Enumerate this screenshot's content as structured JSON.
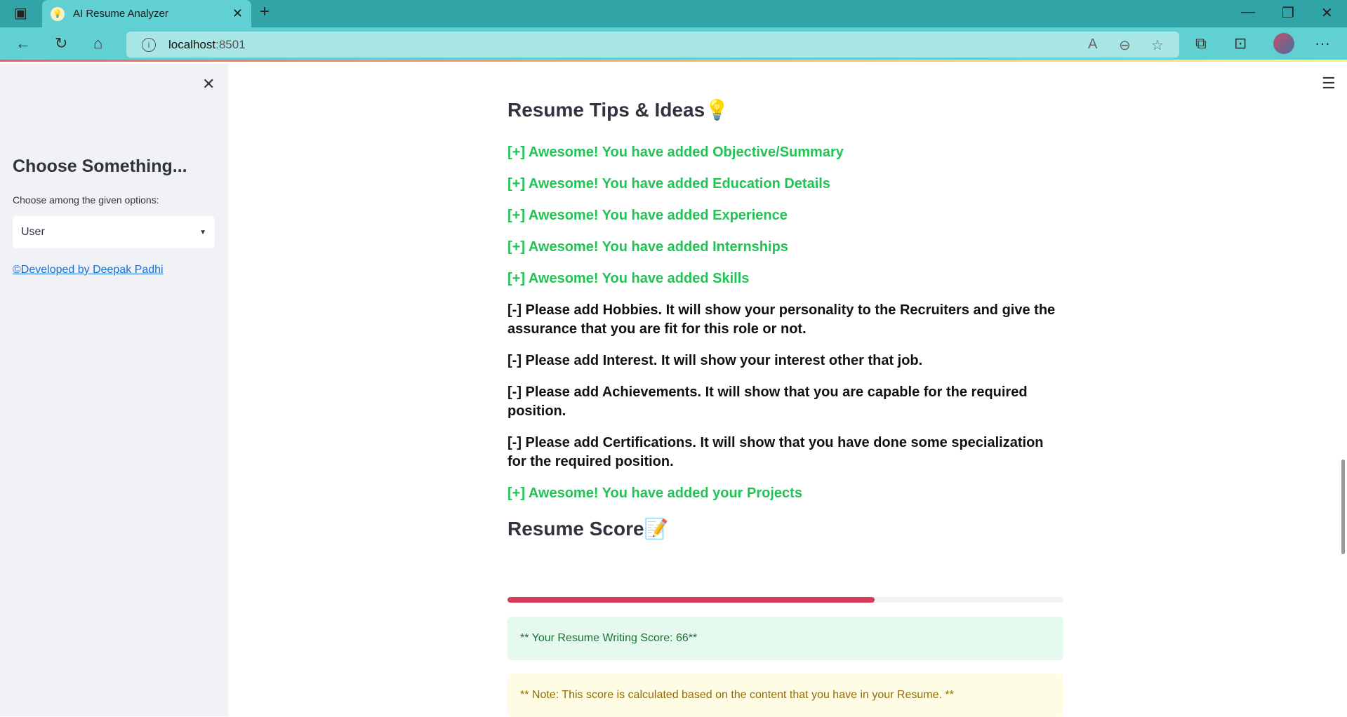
{
  "browser": {
    "tab_title": "AI Resume Analyzer",
    "url_host": "localhost",
    "url_port": ":8501"
  },
  "sidebar": {
    "title": "Choose Something...",
    "select_label": "Choose among the given options:",
    "select_value": "User",
    "footer_link": "©Developed by Deepak Padhi"
  },
  "main": {
    "tips_heading": "Resume Tips & Ideas💡",
    "tips": [
      {
        "text": "[+] Awesome! You have added Objective/Summary",
        "status": "good"
      },
      {
        "text": "[+] Awesome! You have added Education Details",
        "status": "good"
      },
      {
        "text": "[+] Awesome! You have added Experience",
        "status": "good"
      },
      {
        "text": "[+] Awesome! You have added Internships",
        "status": "good"
      },
      {
        "text": "[+] Awesome! You have added Skills",
        "status": "good"
      },
      {
        "text": "[-] Please add Hobbies. It will show your personality to the Recruiters and give the assurance that you are fit for this role or not.",
        "status": "bad"
      },
      {
        "text": "[-] Please add Interest. It will show your interest other that job.",
        "status": "bad"
      },
      {
        "text": "[-] Please add Achievements. It will show that you are capable for the required position.",
        "status": "bad"
      },
      {
        "text": "[-] Please add Certifications. It will show that you have done some specialization for the required position.",
        "status": "bad"
      },
      {
        "text": "[+] Awesome! You have added your Projects",
        "status": "good"
      }
    ],
    "score_heading": "Resume Score📝",
    "score_progress": 66,
    "score_text": "** Your Resume Writing Score: 66**",
    "note_text": "** Note: This score is calculated based on the content that you have in your Resume. **"
  },
  "colors": {
    "good": "#21c354",
    "progress": "#d83c5b",
    "tabbar": "#31a4a7",
    "toolbar": "#61d0d2"
  }
}
